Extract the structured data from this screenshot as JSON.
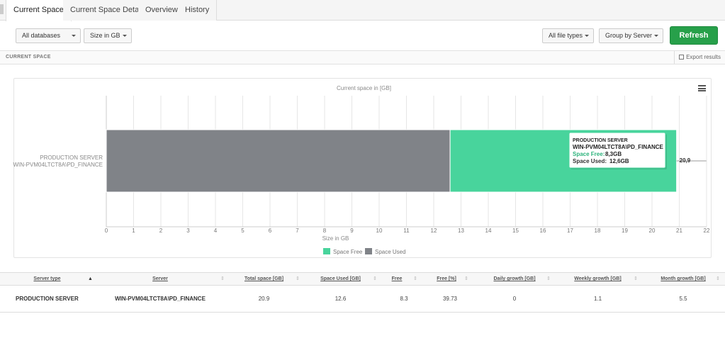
{
  "tabs": [
    {
      "label": "Current Space",
      "active": true
    },
    {
      "label": "Current Space Details",
      "active": false
    },
    {
      "label": "Overview",
      "active": false
    },
    {
      "label": "History",
      "active": false
    }
  ],
  "toolbar": {
    "databases": "All databases",
    "size_unit": "Size in GB",
    "file_types": "All file types",
    "group_by": "Group by Server",
    "refresh": "Refresh"
  },
  "section": {
    "title": "CURRENT SPACE",
    "export": "Export results"
  },
  "colors": {
    "space_free": "#48d49c",
    "space_used": "#808388",
    "refresh": "#27a04a"
  },
  "chart_data": {
    "type": "bar",
    "orientation": "horizontal",
    "stacked": true,
    "title": "Current space in [GB]",
    "xlabel": "Size in GB",
    "xlim": [
      0,
      22
    ],
    "xticks": [
      0,
      1,
      2,
      3,
      4,
      5,
      6,
      7,
      8,
      9,
      10,
      11,
      12,
      13,
      14,
      15,
      16,
      17,
      18,
      19,
      20,
      21,
      22
    ],
    "categories": [
      "PRODUCTION SERVER\nWIN-PVM04LTCT8A\\PD_FINANCE"
    ],
    "category_lines": [
      "PRODUCTION SERVER",
      "WIN-PVM04LTCT8A\\PD_FINANCE"
    ],
    "series": [
      {
        "name": "Space Used",
        "values": [
          12.6
        ],
        "color": "#808388"
      },
      {
        "name": "Space Free",
        "values": [
          8.3
        ],
        "color": "#48d49c"
      }
    ],
    "legend": [
      "Space Free",
      "Space Used"
    ],
    "legend_placement": "bottom-center",
    "total_labels": [
      "20,9"
    ],
    "tooltip": {
      "lines": [
        "PRODUCTION SERVER",
        "WIN-PVM04LTCT8A\\PD_FINANCE"
      ],
      "free_label": "Space Free:",
      "free_value": "8,3GB",
      "used_label": "Space Used:",
      "used_value": "12,6GB"
    }
  },
  "table": {
    "columns": [
      "Server type",
      "Server",
      "Total space [GB]",
      "Space Used [GB]",
      "Free [GB]",
      "Free [%]",
      "Daily growth [GB]",
      "Weekly growth [GB]",
      "Month growth [GB]"
    ],
    "rows": [
      [
        "PRODUCTION SERVER",
        "WIN-PVM04LTCT8A\\PD_FINANCE",
        "20.9",
        "12.6",
        "8.3",
        "39.73",
        "0",
        "1.1",
        "5.5"
      ]
    ]
  }
}
